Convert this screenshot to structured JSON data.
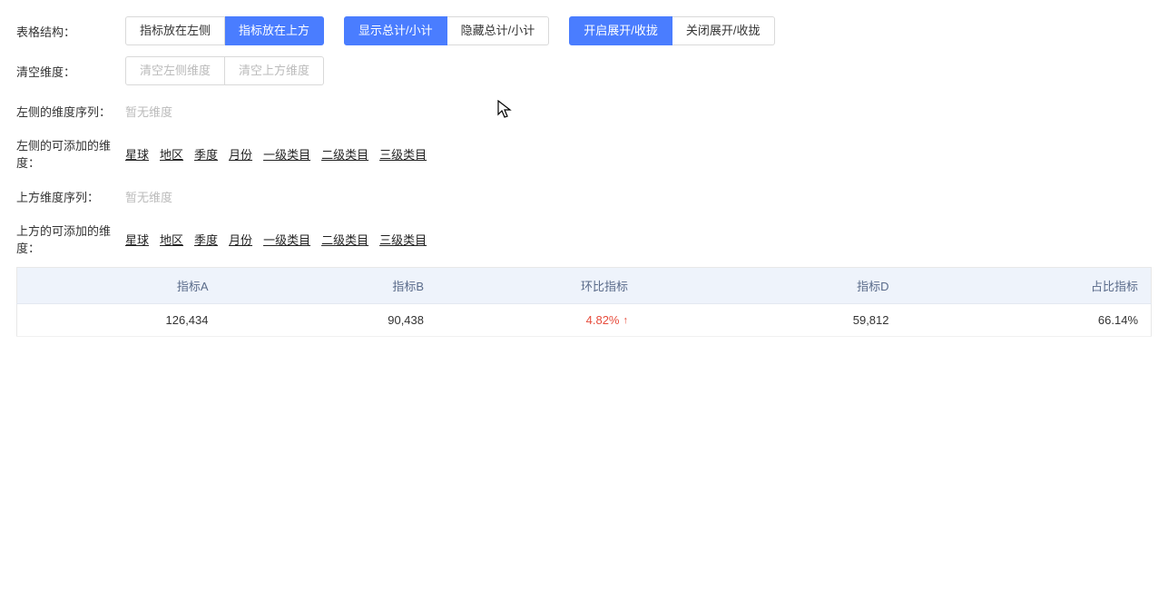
{
  "rows": {
    "structure": {
      "label": "表格结构：",
      "group1": {
        "opt1": "指标放在左侧",
        "opt2": "指标放在上方"
      },
      "group2": {
        "opt1": "显示总计/小计",
        "opt2": "隐藏总计/小计"
      },
      "group3": {
        "opt1": "开启展开/收拢",
        "opt2": "关闭展开/收拢"
      }
    },
    "clear": {
      "label": "清空维度：",
      "btn1": "清空左侧维度",
      "btn2": "清空上方维度"
    },
    "leftSeq": {
      "label": "左侧的维度序列：",
      "placeholder": "暂无维度"
    },
    "leftAdd": {
      "label": "左侧的可添加的维度：",
      "dims": [
        "星球",
        "地区",
        "季度",
        "月份",
        "一级类目",
        "二级类目",
        "三级类目"
      ]
    },
    "topSeq": {
      "label": "上方维度序列：",
      "placeholder": "暂无维度"
    },
    "topAdd": {
      "label": "上方的可添加的维度：",
      "dims": [
        "星球",
        "地区",
        "季度",
        "月份",
        "一级类目",
        "二级类目",
        "三级类目"
      ]
    }
  },
  "table": {
    "headers": [
      "指标A",
      "指标B",
      "环比指标",
      "指标D",
      "占比指标"
    ],
    "row": {
      "a": "126,434",
      "b": "90,438",
      "c_value": "4.82%",
      "c_trend": "up",
      "d": "59,812",
      "e": "66.14%"
    }
  }
}
